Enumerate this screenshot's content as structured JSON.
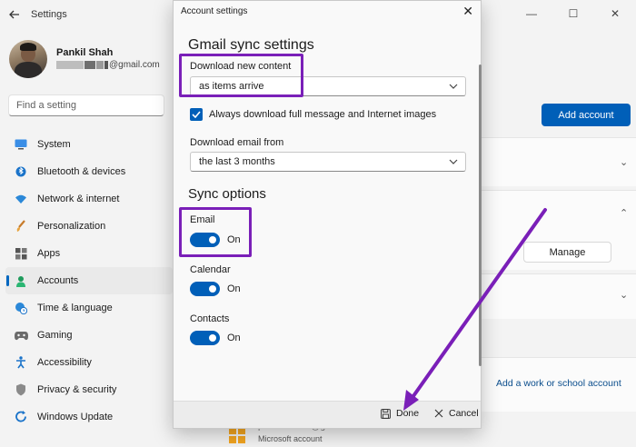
{
  "window": {
    "title": "Settings"
  },
  "profile": {
    "name": "Pankil Shah",
    "email_suffix": "@gmail.com"
  },
  "search": {
    "placeholder": "Find a setting"
  },
  "nav": {
    "items": [
      {
        "label": "System",
        "icon": "monitor-icon"
      },
      {
        "label": "Bluetooth & devices",
        "icon": "bluetooth-icon"
      },
      {
        "label": "Network & internet",
        "icon": "wifi-icon"
      },
      {
        "label": "Personalization",
        "icon": "brush-icon"
      },
      {
        "label": "Apps",
        "icon": "apps-icon"
      },
      {
        "label": "Accounts",
        "icon": "person-icon",
        "active": true
      },
      {
        "label": "Time & language",
        "icon": "globe-clock-icon"
      },
      {
        "label": "Gaming",
        "icon": "gamepad-icon"
      },
      {
        "label": "Accessibility",
        "icon": "accessibility-icon"
      },
      {
        "label": "Privacy & security",
        "icon": "shield-icon"
      },
      {
        "label": "Windows Update",
        "icon": "refresh-icon"
      }
    ]
  },
  "main": {
    "add_account": "Add account",
    "manage": "Manage",
    "work_school_link": "Add a work or school account",
    "ms_account_partial": "pankil…2330@gmail.com",
    "ms_account_type": "Microsoft account"
  },
  "dialog": {
    "title": "Account settings",
    "heading": "Gmail sync settings",
    "download_new_content_label": "Download new content",
    "download_new_content_value": "as items arrive",
    "always_download_label": "Always download full message and Internet images",
    "download_email_from_label": "Download email from",
    "download_email_from_value": "the last 3 months",
    "sync_options_heading": "Sync options",
    "email_label": "Email",
    "email_state": "On",
    "calendar_label": "Calendar",
    "calendar_state": "On",
    "contacts_label": "Contacts",
    "contacts_state": "On",
    "done": "Done",
    "cancel": "Cancel"
  },
  "colors": {
    "accent": "#005fb8",
    "highlight": "#7a1fb8"
  }
}
